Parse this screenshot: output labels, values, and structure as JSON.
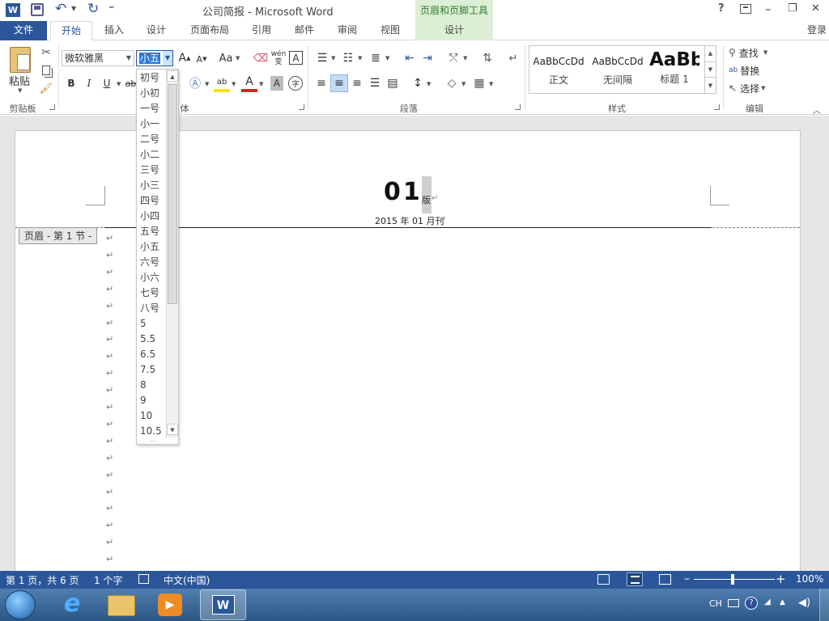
{
  "titlebar": {
    "title": "公司简报 - Microsoft Word",
    "context_tab_group": "页眉和页脚工具",
    "help": "?",
    "minimize": "–",
    "restore": "❐",
    "close": "✕"
  },
  "tabs": {
    "file": "文件",
    "home": "开始",
    "insert": "插入",
    "design": "设计",
    "layout": "页面布局",
    "references": "引用",
    "mailings": "邮件",
    "review": "审阅",
    "view": "视图",
    "hf_design": "设计",
    "login": "登录"
  },
  "clipboard": {
    "paste": "粘贴",
    "group": "剪贴板"
  },
  "font": {
    "name": "微软雅黑",
    "size": "小五",
    "group_suffix": "体",
    "bold": "B",
    "italic": "I",
    "underline": "U",
    "grow": "A",
    "shrink": "A",
    "case": "Aa",
    "phonetic": "wén 变",
    "border_char": "A",
    "char_shading": "A",
    "enclose": "字"
  },
  "paragraph": {
    "group": "段落"
  },
  "styles": {
    "group": "样式",
    "items": [
      {
        "preview": "AaBbCcDd",
        "name": "正文"
      },
      {
        "preview": "AaBbCcDd",
        "name": "无间隔"
      },
      {
        "preview": "AaBb",
        "name": "标题 1"
      }
    ]
  },
  "editing": {
    "group": "编辑",
    "find": "查找",
    "replace": "替换",
    "select": "选择"
  },
  "fontsize_options": [
    "初号",
    "小初",
    "一号",
    "小一",
    "二号",
    "小二",
    "三号",
    "小三",
    "四号",
    "小四",
    "五号",
    "小五",
    "六号",
    "小六",
    "七号",
    "八号",
    "5",
    "5.5",
    "6.5",
    "7.5",
    "8",
    "9",
    "10",
    "10.5"
  ],
  "document": {
    "header_number": "01",
    "header_suffix": "版",
    "header_date": "2015 年 01 月刊",
    "header_tag": "页眉 - 第 1 节 -",
    "return_mark": "↵"
  },
  "status": {
    "page": "第 1 页，共 6 页",
    "words": "1 个字",
    "language": "中文(中国)",
    "zoom": "100%",
    "zoom_minus": "–",
    "zoom_plus": "+"
  },
  "taskbar": {
    "lang": "CH"
  },
  "colors": {
    "accent": "#2b579a",
    "context": "#dcefd4",
    "font_color": "#e02020",
    "highlight": "#f5e600"
  }
}
